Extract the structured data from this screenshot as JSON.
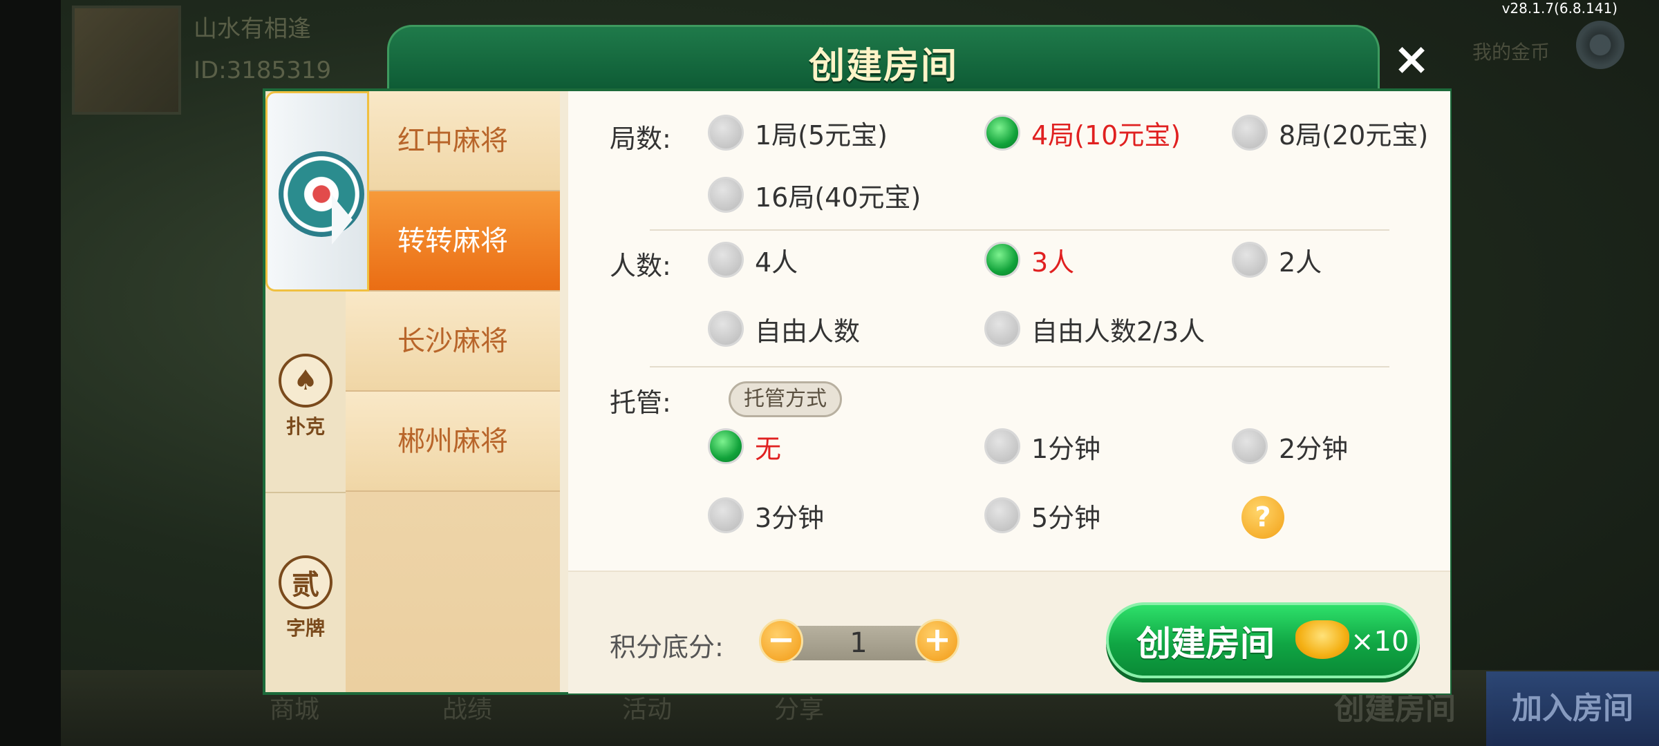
{
  "background": {
    "player_name": "山水有相逢",
    "player_id": "ID:3185319",
    "version": "v28.1.7(6.8.141)",
    "top_right_label": "我的金币",
    "bottom_nav": [
      "商城",
      "战绩",
      "活动",
      "分享"
    ],
    "create_room_ghost": "创建房间",
    "join_room": "加入房间"
  },
  "dialog": {
    "title": "创建房间",
    "close": "×",
    "categories": [
      {
        "icon": "mahjong-icon",
        "label": ""
      },
      {
        "icon": "spade-icon",
        "symbol": "♠",
        "label": "扑克"
      },
      {
        "icon": "character-icon",
        "symbol": "贰",
        "label": "字牌"
      }
    ],
    "game_tabs": [
      "红中麻将",
      "转转麻将",
      "长沙麻将",
      "郴州麻将"
    ],
    "active_tab": "转转麻将",
    "rounds": {
      "label": "局数:",
      "options": [
        "1局(5元宝)",
        "4局(10元宝)",
        "8局(20元宝)",
        "16局(40元宝)"
      ],
      "selected": "4局(10元宝)"
    },
    "players": {
      "label": "人数:",
      "options": [
        "4人",
        "3人",
        "2人",
        "自由人数",
        "自由人数2/3人"
      ],
      "selected": "3人"
    },
    "auto_play": {
      "label": "托管:",
      "mode_button": "托管方式",
      "options": [
        "无",
        "1分钟",
        "2分钟",
        "3分钟",
        "5分钟"
      ],
      "selected": "无",
      "help": "?"
    },
    "score": {
      "label": "积分底分:",
      "value": "1",
      "minus": "−",
      "plus": "+"
    },
    "create_button": {
      "label": "创建房间",
      "cost": "×10"
    }
  }
}
